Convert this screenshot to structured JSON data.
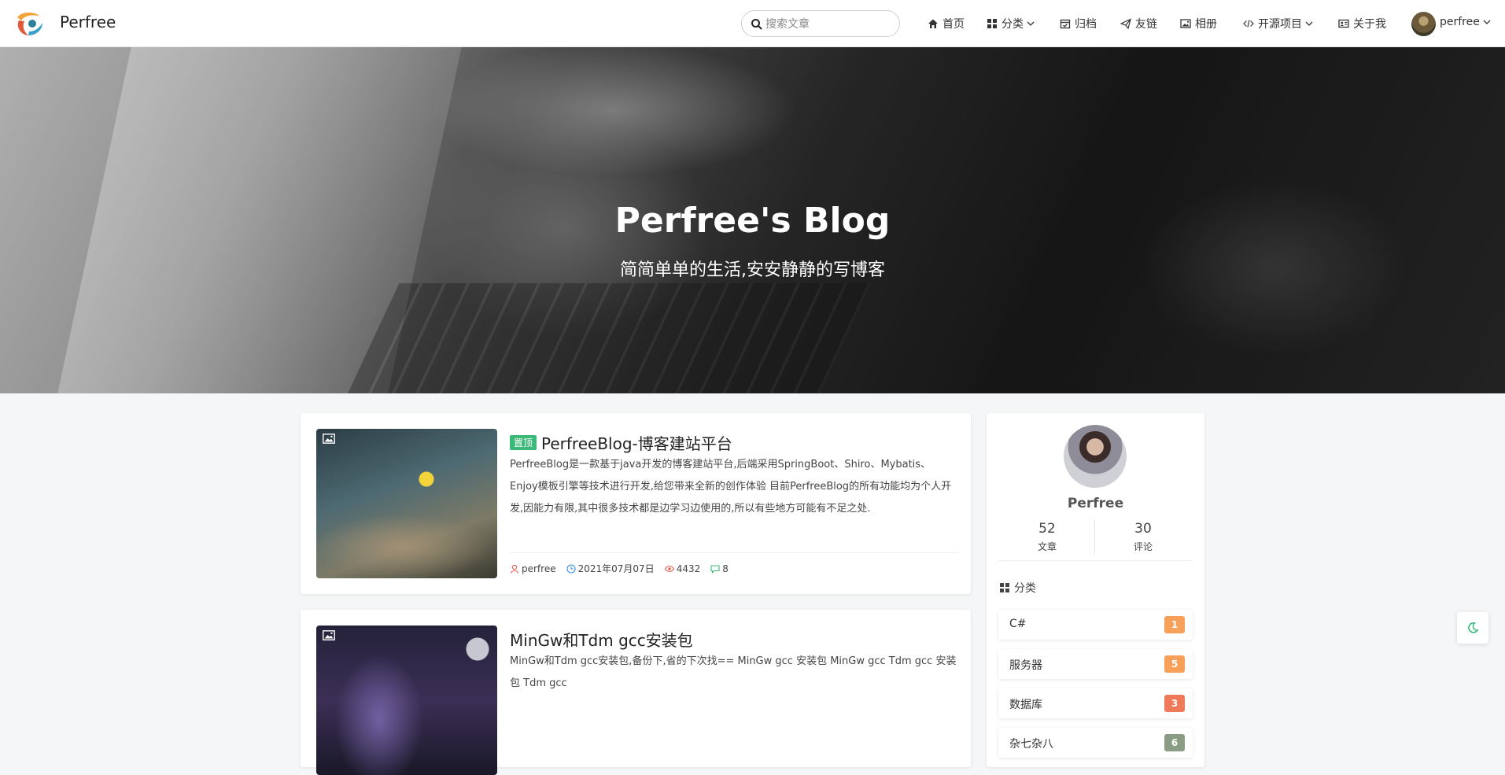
{
  "header": {
    "brand": "Perfree",
    "search_placeholder": "搜索文章",
    "nav": {
      "home": "首页",
      "categories": "分类",
      "archive": "归档",
      "links": "友链",
      "album": "相册",
      "open_source": "开源项目",
      "about": "关于我"
    },
    "user": "perfree"
  },
  "hero": {
    "title": "Perfree's Blog",
    "subtitle": "简简单单的生活,安安静静的写博客"
  },
  "articles": [
    {
      "pinned_label": "置顶",
      "title": "PerfreeBlog-博客建站平台",
      "summary": "PerfreeBlog是一款基于java开发的博客建站平台,后端采用SpringBoot、Shiro、Mybatis、Enjoy模板引擎等技术进行开发,给您带来全新的创作体验 目前PerfreeBlog的所有功能均为个人开发,因能力有限,其中很多技术都是边学习边使用的,所以有些地方可能有不足之处.",
      "author": "perfree",
      "date": "2021年07月07日",
      "views": "4432",
      "comments": "8"
    },
    {
      "title": "MinGw和Tdm gcc安装包",
      "summary": "MinGw和Tdm gcc安装包,备份下,省的下次找== MinGw gcc 安装包 MinGw gcc Tdm gcc 安装包 Tdm gcc"
    }
  ],
  "sidebar": {
    "name": "Perfree",
    "stats": [
      {
        "value": "52",
        "label": "文章"
      },
      {
        "value": "30",
        "label": "评论"
      }
    ],
    "category_heading": "分类",
    "categories": [
      {
        "name": "C#",
        "count": "1",
        "color": "#f6a05a"
      },
      {
        "name": "服务器",
        "count": "5",
        "color": "#f6a05a"
      },
      {
        "name": "数据库",
        "count": "3",
        "color": "#ee7a5a"
      },
      {
        "name": "杂七杂八",
        "count": "6",
        "color": "#8a9c84"
      }
    ]
  },
  "colors": {
    "pinned": "#3cb878",
    "author_icon": "#e8554e",
    "date_icon": "#3a8ee6",
    "views_icon": "#e8554e",
    "comments_icon": "#3cb878",
    "accent": "#2bb673"
  }
}
